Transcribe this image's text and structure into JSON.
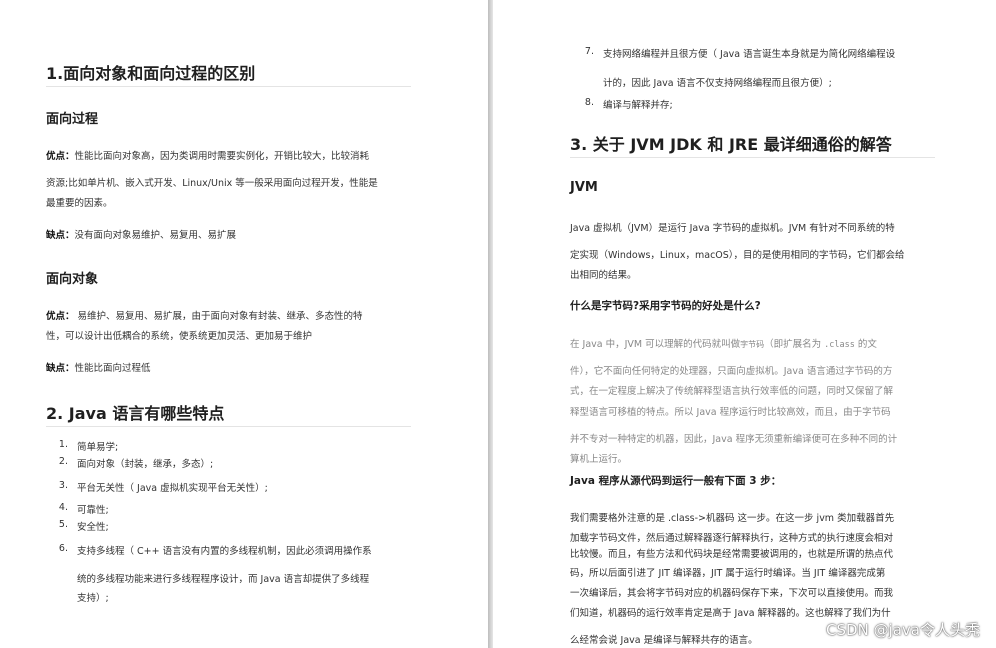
{
  "left": {
    "s1_title": "1.面向对象和面向过程的区别",
    "procedural": {
      "heading": "面向过程",
      "pros_label": "优点：",
      "pros_l1": "性能比面向对象高，因为类调用时需要实例化，开销比较大，比较消耗",
      "pros_l2": "资源;比如单片机、嵌入式开发、Linux/Unix 等一般采用面向过程开发，性能是",
      "pros_l3": "最重要的因素。",
      "cons_label": "缺点：",
      "cons_text": "没有面向对象易维护、易复用、易扩展"
    },
    "oop": {
      "heading": "面向对象",
      "pros_label": "优点：",
      "pros_l1": " 易维护、易复用、易扩展，由于面向对象有封装、继承、多态性的特",
      "pros_l2": "性，可以设计出低耦合的系统，使系统更加灵活、更加易于维护",
      "cons_label": "缺点：",
      "cons_text": "性能比面向过程低"
    },
    "s2_title": "2. Java  语言有哪些特点",
    "list": [
      {
        "num": "1.",
        "lines": [
          "简单易学;"
        ]
      },
      {
        "num": "2.",
        "lines": [
          "面向对象（封装，继承，多态）;"
        ]
      },
      {
        "num": "3.",
        "lines": [
          "平台无关性（  Java  虚拟机实现平台无关性）;"
        ]
      },
      {
        "num": "4.",
        "lines": [
          "可靠性;"
        ]
      },
      {
        "num": "5.",
        "lines": [
          "安全性;"
        ]
      },
      {
        "num": "6.",
        "lines": [
          "支持多线程（  C++  语言没有内置的多线程机制，因此必须调用操作系",
          "统的多线程功能来进行多线程程序设计，而  Java  语言却提供了多线程",
          "支持）;"
        ]
      }
    ]
  },
  "right": {
    "list": [
      {
        "num": "7.",
        "lines": [
          "支持网络编程并且很方便（  Java  语言诞生本身就是为简化网络编程设",
          "计的，因此  Java  语言不仅支持网络编程而且很方便）;"
        ]
      },
      {
        "num": "8.",
        "lines": [
          "编译与解释并存;"
        ]
      }
    ],
    "s3_title": "3.  关于  JVM JDK  和  JRE  最详细通俗的解答",
    "jvm_heading": "JVM",
    "jvm_p1": "Java 虚拟机（JVM）是运行  Java  字节码的虚拟机。JVM 有针对不同系统的特",
    "jvm_p2": "定实现（Windows，Linux，macOS），目的是使用相同的字节码，它们都会给",
    "jvm_p3": "出相同的结果。",
    "q1": "什么是字节码?采用字节码的好处是什么?",
    "bc_l1a": "在  Java  中，JVM 可以理解的代码就叫做",
    "bc_l1b": "字节码",
    "bc_l1c": "（即扩展名为 ",
    "bc_l1d": ".class",
    "bc_l1e": " 的文",
    "bc_l2": "件），它不面向任何特定的处理器，只面向虚拟机。Java  语言通过字节码的方",
    "bc_l3": "式，在一定程度上解决了传统解释型语言执行效率低的问题，同时又保留了解",
    "bc_l4": "释型语言可移植的特点。所以  Java  程序运行时比较高效，而且，由于字节码",
    "bc_l5": "并不专对一种特定的机器，因此，Java 程序无须重新编译便可在多种不同的计",
    "bc_l6": "算机上运行。",
    "q2": "Java  程序从源代码到运行一般有下面 3 步：",
    "run_l1": "我们需要格外注意的是  .class->机器码  这一步。在这一步  jvm  类加载器首先",
    "run_l2": "加载字节码文件，然后通过解释器逐行解释执行，这种方式的执行速度会相对",
    "run_l3": "比较慢。而且，有些方法和代码块是经常需要被调用的，也就是所谓的热点代",
    "run_l4": "码，所以后面引进了  JIT  编译器，JIT 属于运行时编译。当  JIT  编译器完成第",
    "run_l5": "一次编译后，其会将字节码对应的机器码保存下来，下次可以直接使用。而我",
    "run_l6": "们知道，机器码的运行效率肯定是高于  Java  解释器的。这也解释了我们为什",
    "run_l7": "么经常会说  Java  是编译与解释共存的语言。"
  },
  "watermark": "CSDN @java令人头秃"
}
